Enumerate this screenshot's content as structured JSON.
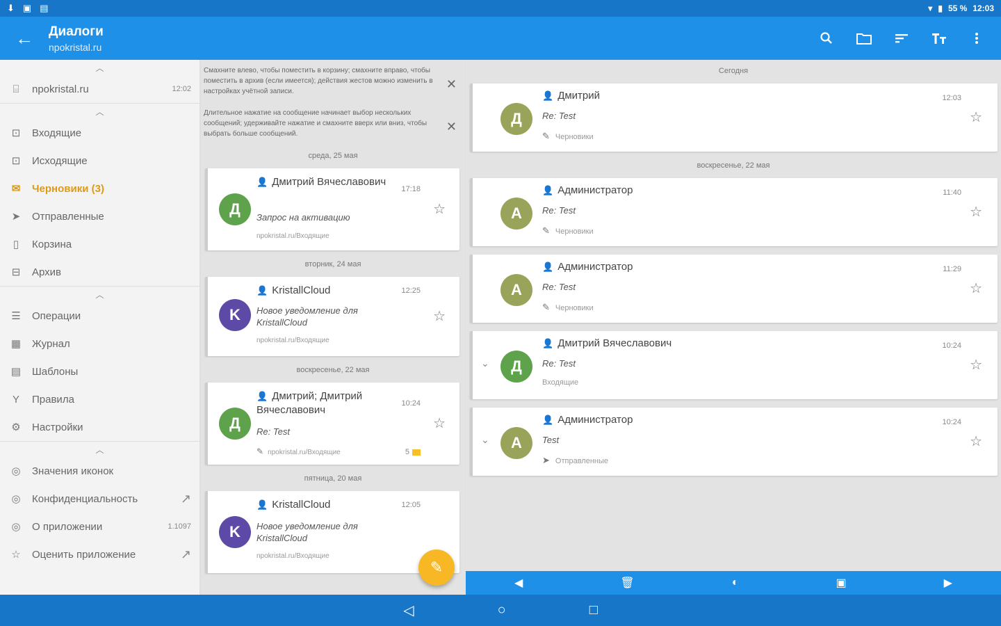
{
  "statusbar": {
    "battery": "55 %",
    "time": "12:03"
  },
  "colors": {
    "primary": "#1e90e8",
    "accent": "#f8b826",
    "active": "#e09a12",
    "avatar_green": "#5ea34c",
    "avatar_olive": "#9aa35a",
    "avatar_purple": "#5c4aa6"
  },
  "appbar": {
    "title": "Диалоги",
    "subtitle": "npokristal.ru",
    "actions": [
      "search-icon",
      "folder-icon",
      "sort-icon",
      "text-size-icon",
      "more-icon"
    ]
  },
  "sidebar": {
    "account": {
      "label": "npokristal.ru",
      "time": "12:02"
    },
    "folders": [
      {
        "label": "Входящие",
        "icon": "inbox-icon"
      },
      {
        "label": "Исходящие",
        "icon": "outbox-icon"
      },
      {
        "label": "Черновики (3)",
        "icon": "drafts-icon",
        "active": true
      },
      {
        "label": "Отправленные",
        "icon": "sent-icon"
      },
      {
        "label": "Корзина",
        "icon": "trash-icon"
      },
      {
        "label": "Архив",
        "icon": "archive-icon"
      }
    ],
    "tools": [
      {
        "label": "Операции",
        "icon": "operations-icon"
      },
      {
        "label": "Журнал",
        "icon": "log-icon"
      },
      {
        "label": "Шаблоны",
        "icon": "templates-icon"
      },
      {
        "label": "Правила",
        "icon": "filter-icon"
      },
      {
        "label": "Настройки",
        "icon": "settings-icon"
      }
    ],
    "about": [
      {
        "label": "Значения иконок",
        "icon": "info-icon"
      },
      {
        "label": "Конфиденциальность",
        "icon": "privacy-icon",
        "right": "↗"
      },
      {
        "label": "О приложении",
        "icon": "about-icon",
        "right": "1.1097"
      },
      {
        "label": "Оценить приложение",
        "icon": "star-icon",
        "right": "↗"
      }
    ]
  },
  "hints": [
    "Смахните влево, чтобы поместить в корзину; смахните вправо, чтобы поместить в архив (если имеется); действия жестов можно изменить в настройках учётной записи.",
    "Длительное нажатие на сообщение начинает выбор нескольких сообщений; удерживайте нажатие и смахните вверх или вниз, чтобы выбрать больше сообщений."
  ],
  "middle": {
    "groups": [
      {
        "day": "среда, 25 мая",
        "cards": [
          {
            "avatar": "Д",
            "avatar_color": "#5ea34c",
            "sender": "Дмитрий Вячеславович",
            "time": "17:18",
            "subject": "Запрос на активацию",
            "folder": "npokristal.ru/Входящие"
          }
        ]
      },
      {
        "day": "вторник, 24 мая",
        "cards": [
          {
            "avatar": "K",
            "avatar_color": "#5c4aa6",
            "sender": "KristallCloud",
            "time": "12:25",
            "subject": "Новое уведомление для KristallCloud",
            "folder": "npokristal.ru/Входящие"
          }
        ]
      },
      {
        "day": "воскресенье, 22 мая",
        "cards": [
          {
            "avatar": "Д",
            "avatar_color": "#5ea34c",
            "sender": "Дмитрий; Дмитрий Вячеславович",
            "time": "10:24",
            "subject": "Re: Test",
            "folder": "npokristal.ru/Входящие",
            "badge": "5"
          }
        ]
      },
      {
        "day": "пятница, 20 мая",
        "cards": [
          {
            "avatar": "K",
            "avatar_color": "#5c4aa6",
            "sender": "KristallCloud",
            "time": "12:05",
            "subject": "Новое уведомление для KristallCloud",
            "folder": "npokristal.ru/Входящие"
          }
        ]
      }
    ]
  },
  "right": {
    "groups": [
      {
        "day": "Сегодня",
        "cards": [
          {
            "avatar": "Д",
            "avatar_color": "#9aa35a",
            "sender": "Дмитрий",
            "time": "12:03",
            "subject": "Re: Test",
            "folder": "Черновики",
            "folder_icon": "✎"
          }
        ]
      },
      {
        "day": "воскресенье, 22 мая",
        "cards": [
          {
            "avatar": "А",
            "avatar_color": "#9aa35a",
            "sender": "Администратор",
            "time": "11:40",
            "subject": "Re: Test",
            "folder": "Черновики",
            "folder_icon": "✎"
          },
          {
            "avatar": "А",
            "avatar_color": "#9aa35a",
            "sender": "Администратор",
            "time": "11:29",
            "subject": "Re: Test",
            "folder": "Черновики",
            "folder_icon": "✎"
          },
          {
            "avatar": "Д",
            "avatar_color": "#5ea34c",
            "sender": "Дмитрий Вячеславович",
            "time": "10:24",
            "subject": "Re: Test",
            "folder": "Входящие",
            "folder_icon": "",
            "chevron": true
          },
          {
            "avatar": "А",
            "avatar_color": "#9aa35a",
            "sender": "Администратор",
            "time": "10:24",
            "subject": "Test",
            "folder": "Отправленные",
            "folder_icon": "➤",
            "chevron": true
          }
        ]
      }
    ]
  },
  "bottom_actions": [
    "prev-icon",
    "delete-icon",
    "mark-icon",
    "calendar-icon",
    "next-icon"
  ],
  "fab": {
    "icon": "edit-icon"
  }
}
